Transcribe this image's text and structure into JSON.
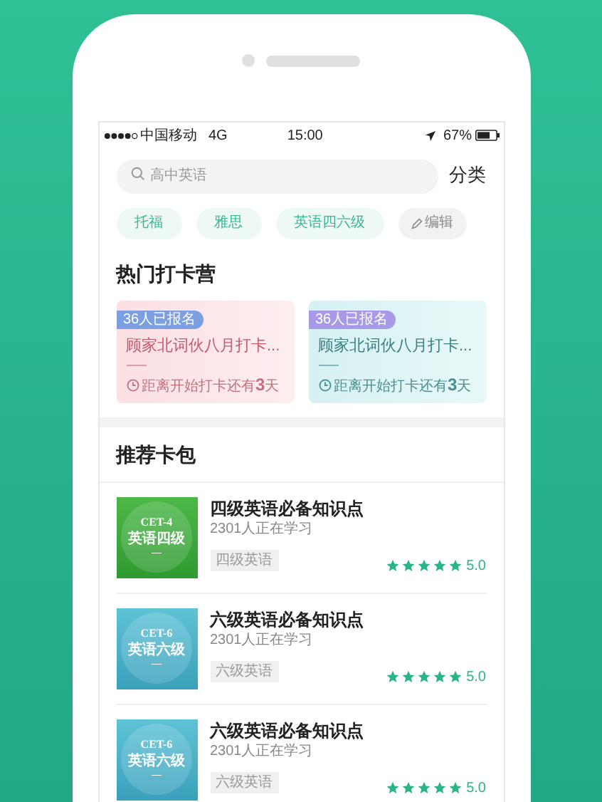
{
  "status_bar": {
    "carrier": "中国移动",
    "network": "4G",
    "time": "15:00",
    "battery": "67%"
  },
  "search": {
    "placeholder": "高中英语",
    "action": "分类"
  },
  "tags": [
    {
      "kind": "tag",
      "label": "托福"
    },
    {
      "kind": "tag",
      "label": "雅思"
    },
    {
      "kind": "tag",
      "label": "英语四六级"
    },
    {
      "kind": "edit",
      "label": "编辑"
    }
  ],
  "camps": {
    "title": "热门打卡营",
    "items": [
      {
        "kind": "pink",
        "badge": "36人已报名",
        "title": "顾家北词伙八月打卡...",
        "countdown": "距离开始打卡还有**3**天"
      },
      {
        "kind": "teal",
        "badge": "36人已报名",
        "title": "顾家北词伙八月打卡...",
        "countdown": "距离开始打卡还有**3**天"
      }
    ]
  },
  "packs": {
    "title": "推荐卡包",
    "items": [
      {
        "kind": "green",
        "cover": [
          "CET-4",
          "英语四级",
          "—"
        ],
        "title": "四级英语必备知识点",
        "learners": "2301人正在学习",
        "tag": "四级英语",
        "stars": 5,
        "rating": "5.0"
      },
      {
        "kind": "blue",
        "cover": [
          "CET-6",
          "英语六级",
          "—"
        ],
        "title": "六级英语必备知识点",
        "learners": "2301人正在学习",
        "tag": "六级英语",
        "stars": 5,
        "rating": "5.0"
      },
      {
        "kind": "blue",
        "cover": [
          "CET-6",
          "英语六级",
          "—"
        ],
        "title": "六级英语必备知识点",
        "learners": "2301人正在学习",
        "tag": "六级英语",
        "stars": 5,
        "rating": "5.0"
      }
    ]
  }
}
